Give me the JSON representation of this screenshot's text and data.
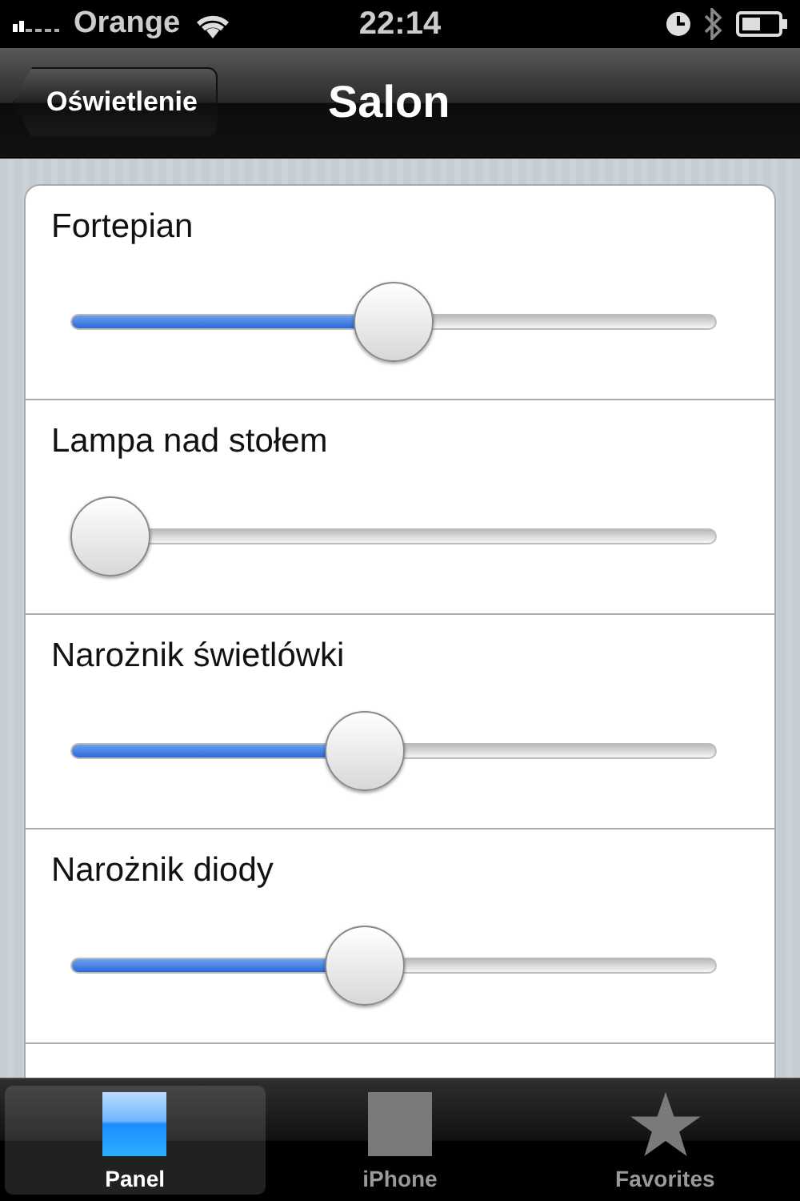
{
  "status_bar": {
    "carrier": "Orange",
    "time": "22:14"
  },
  "nav_bar": {
    "back_button": "Oświetlenie",
    "title": "Salon"
  },
  "sliders": [
    {
      "label": "Fortepian",
      "level": 0.5
    },
    {
      "label": "Lampa nad stołem",
      "level": 0
    },
    {
      "label": "Narożnik świetlówki",
      "level": 0.45
    },
    {
      "label": "Narożnik diody",
      "level": 0.45
    }
  ],
  "tabs": [
    {
      "label": "Panel",
      "kind": "panel",
      "selected": true
    },
    {
      "label": "iPhone",
      "kind": "square",
      "selected": false
    },
    {
      "label": "Favorites",
      "kind": "star",
      "selected": false
    }
  ]
}
